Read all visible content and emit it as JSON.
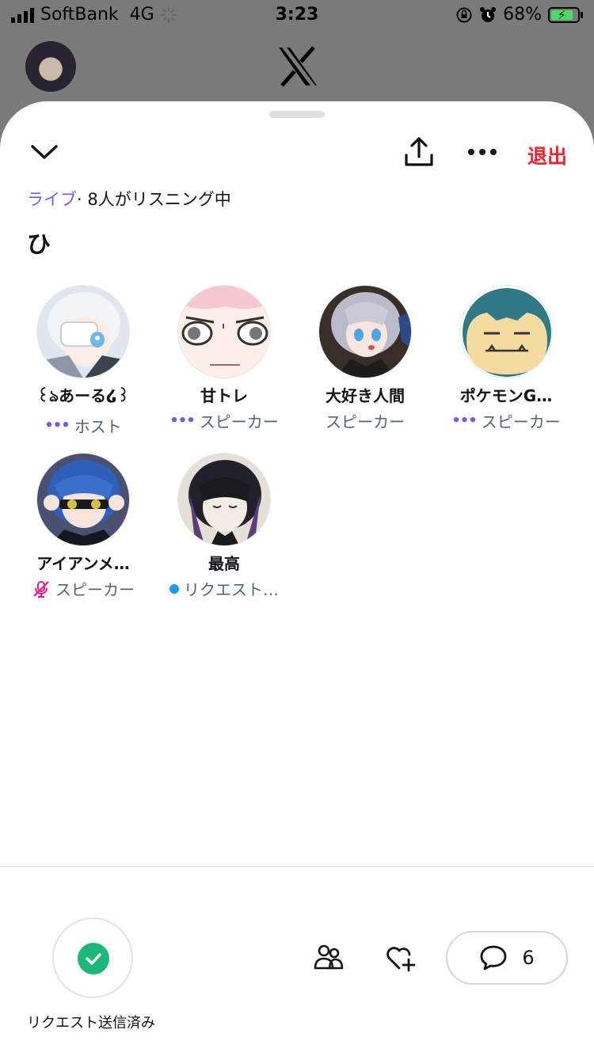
{
  "status_bar": {
    "carrier": "SoftBank",
    "network": "4G",
    "time": "3:23",
    "battery_percent": "68%",
    "battery_level": 0.68,
    "icons": [
      "signal-icon",
      "loading-spinner-icon",
      "rotation-lock-icon",
      "alarm-icon",
      "battery-charging-icon"
    ]
  },
  "background_app": {
    "logo": "x-logo-icon",
    "avatar": "profile-avatar"
  },
  "space": {
    "header_icons": [
      "chevron-down-icon",
      "share-icon",
      "more-icon"
    ],
    "leave_label": "退出",
    "live_label": "ライブ",
    "listening_text": "· 8人がリスニング中",
    "title": "ひ",
    "participants": [
      {
        "name": "꒰ঌあーる໒꒱",
        "role": "ホスト",
        "indicator": "speaking-dots-icon",
        "avatar": "white-haired-anime-avatar"
      },
      {
        "name": "甘トレ",
        "role": "スピーカー",
        "indicator": "speaking-dots-icon",
        "avatar": "anime-face-closeup-avatar"
      },
      {
        "name": "大好き人間",
        "role": "スピーカー",
        "indicator": "",
        "avatar": "silver-haired-anime-avatar"
      },
      {
        "name": "ポケモンG…",
        "role": "スピーカー",
        "indicator": "speaking-dots-icon",
        "avatar": "snorlax-avatar"
      },
      {
        "name": "アイアンメ…",
        "role": "スピーカー",
        "indicator": "muted-mic-icon",
        "avatar": "blue-haired-anime-avatar"
      },
      {
        "name": "最高",
        "role": "リクエスト…",
        "indicator": "request-dot-icon",
        "avatar": "black-haired-anime-avatar"
      }
    ]
  },
  "bottom_bar": {
    "request_label": "リクエスト送信済み",
    "comment_count": "6",
    "icons": [
      "check-icon",
      "people-icon",
      "heart-plus-icon",
      "comment-icon"
    ]
  },
  "colors": {
    "accent_purple": "#7856ff",
    "leave_red": "#f4212e",
    "check_green": "#1db77a",
    "request_blue": "#1d9bf0",
    "muted_pink": "#f91880"
  }
}
